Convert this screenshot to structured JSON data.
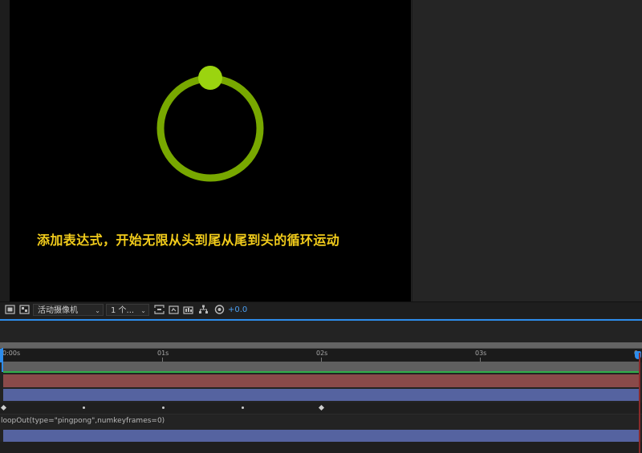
{
  "viewer": {
    "caption": "添加表达式，开始无限从头到尾从尾到头的循环运动",
    "colors": {
      "ring": "#78a800",
      "dot": "#9bd40f",
      "caption": "#f2cc1b",
      "background": "#000000"
    }
  },
  "toolbar": {
    "camera_dropdown": "活动摄像机",
    "view_dropdown": "1 个...",
    "exposure": "+0.0",
    "icons": [
      "region-of-interest-icon",
      "transparency-grid-icon",
      "camera-view-icon",
      "snapshot-icon",
      "show-snapshot-icon",
      "channel-icon",
      "flowchart-icon",
      "exposure-reset-icon"
    ]
  },
  "timeline": {
    "ruler_labels": [
      "0:00s",
      "01s",
      "02s",
      "03s",
      "0"
    ],
    "expression": "loopOut(type=\"pingpong\",numkeyframes=0)",
    "colors": {
      "accent": "#2d8ceb",
      "green": "#2fb04a",
      "red_track": "#8a4a4a",
      "blue_track": "#5563a0"
    }
  }
}
